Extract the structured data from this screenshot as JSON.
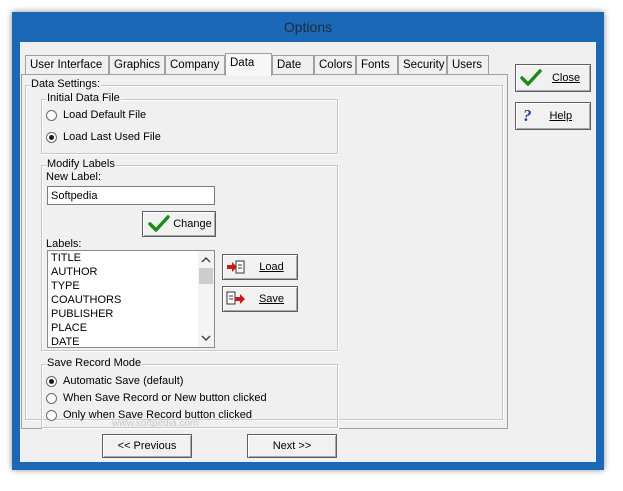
{
  "window": {
    "title": "Options"
  },
  "tabs": [
    {
      "label": "User Interface",
      "active": false
    },
    {
      "label": "Graphics",
      "active": false
    },
    {
      "label": "Company",
      "active": false
    },
    {
      "label": "Data",
      "active": true
    },
    {
      "label": "Date",
      "active": false
    },
    {
      "label": "Colors",
      "active": false
    },
    {
      "label": "Fonts",
      "active": false
    },
    {
      "label": "Security",
      "active": false
    },
    {
      "label": "Users",
      "active": false
    }
  ],
  "data_settings": {
    "title": "Data Settings:",
    "initial_file": {
      "title": "Initial Data File",
      "options": [
        {
          "label": "Load Default File",
          "selected": false
        },
        {
          "label": "Load Last Used File",
          "selected": true
        }
      ]
    },
    "modify_labels": {
      "title": "Modify Labels",
      "new_label_caption": "New Label:",
      "new_label_value": "Softpedia",
      "change_button": "Change",
      "labels_caption": "Labels:",
      "labels": [
        "TITLE",
        "AUTHOR",
        "TYPE",
        "COAUTHORS",
        "PUBLISHER",
        "PLACE",
        "DATE"
      ],
      "load_button": "Load",
      "save_button": "Save"
    },
    "save_mode": {
      "title": "Save Record Mode",
      "options": [
        {
          "label": "Automatic Save (default)",
          "selected": true
        },
        {
          "label": "When Save Record or New button clicked",
          "selected": false
        },
        {
          "label": "Only when Save Record button clicked",
          "selected": false
        }
      ]
    }
  },
  "side_buttons": {
    "close": "Close",
    "help": "Help"
  },
  "footer": {
    "previous": "<< Previous",
    "next": "Next >>"
  },
  "watermark": "www.softpedia.com",
  "colors": {
    "frame": "#1b69b6",
    "check": "#1e8a1e",
    "help": "#1f3f8f",
    "arrow_red": "#d01818"
  }
}
